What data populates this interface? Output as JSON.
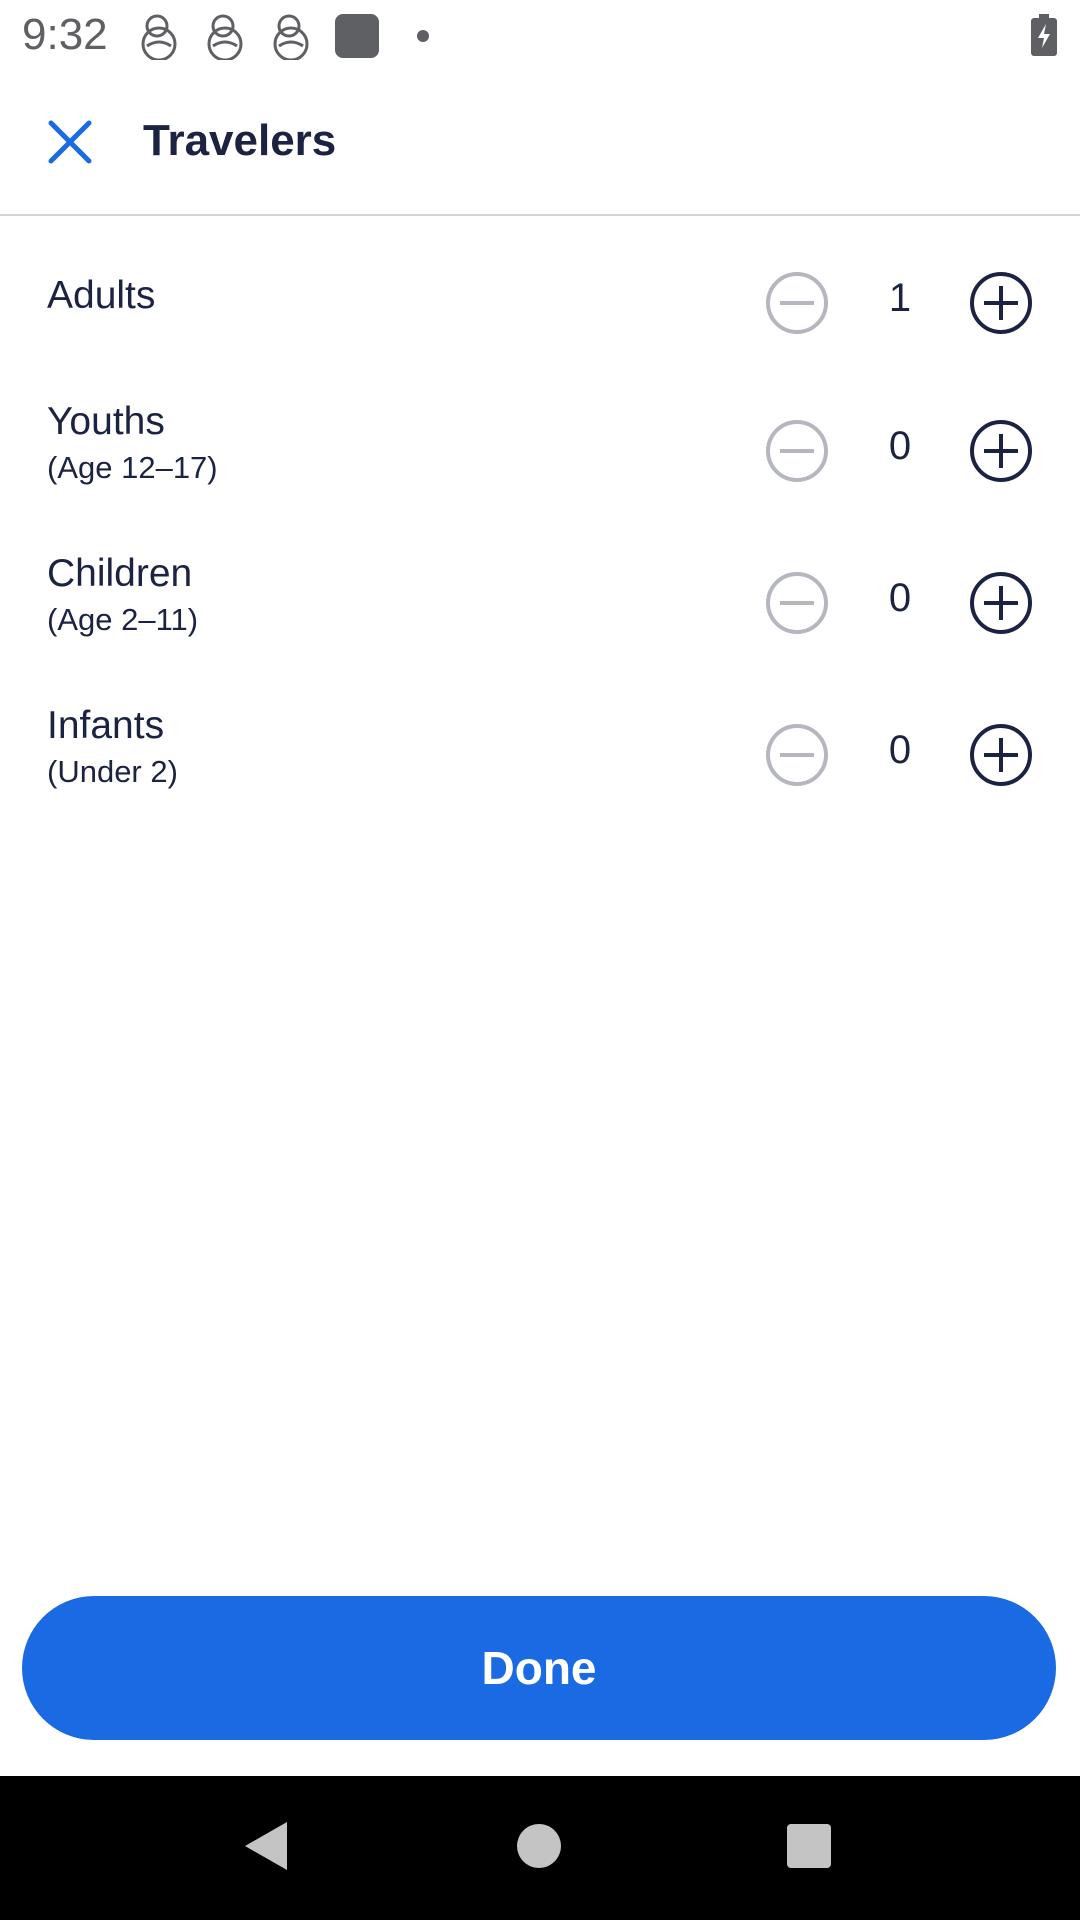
{
  "status_bar": {
    "time": "9:32",
    "icons": [
      "notification-app-icon",
      "notification-app-icon",
      "notification-app-icon",
      "notification-square-icon",
      "more-notifications-dot-icon"
    ],
    "battery_icon": "battery-charging-icon"
  },
  "toolbar": {
    "close_icon": "close-icon",
    "title": "Travelers"
  },
  "travelers": [
    {
      "label": "Adults",
      "sublabel": "",
      "count": "1"
    },
    {
      "label": "Youths",
      "sublabel": "(Age 12–17)",
      "count": "0"
    },
    {
      "label": "Children",
      "sublabel": "(Age 2–11)",
      "count": "0"
    },
    {
      "label": "Infants",
      "sublabel": "(Under 2)",
      "count": "0"
    }
  ],
  "done_button": {
    "label": "Done"
  },
  "colors": {
    "primary": "#1a6ae3",
    "text": "#1c2342",
    "disabled": "#b5b7bf"
  },
  "nav_bar": {
    "back_icon": "back-triangle-icon",
    "home_icon": "home-circle-icon",
    "recents_icon": "recents-square-icon"
  }
}
